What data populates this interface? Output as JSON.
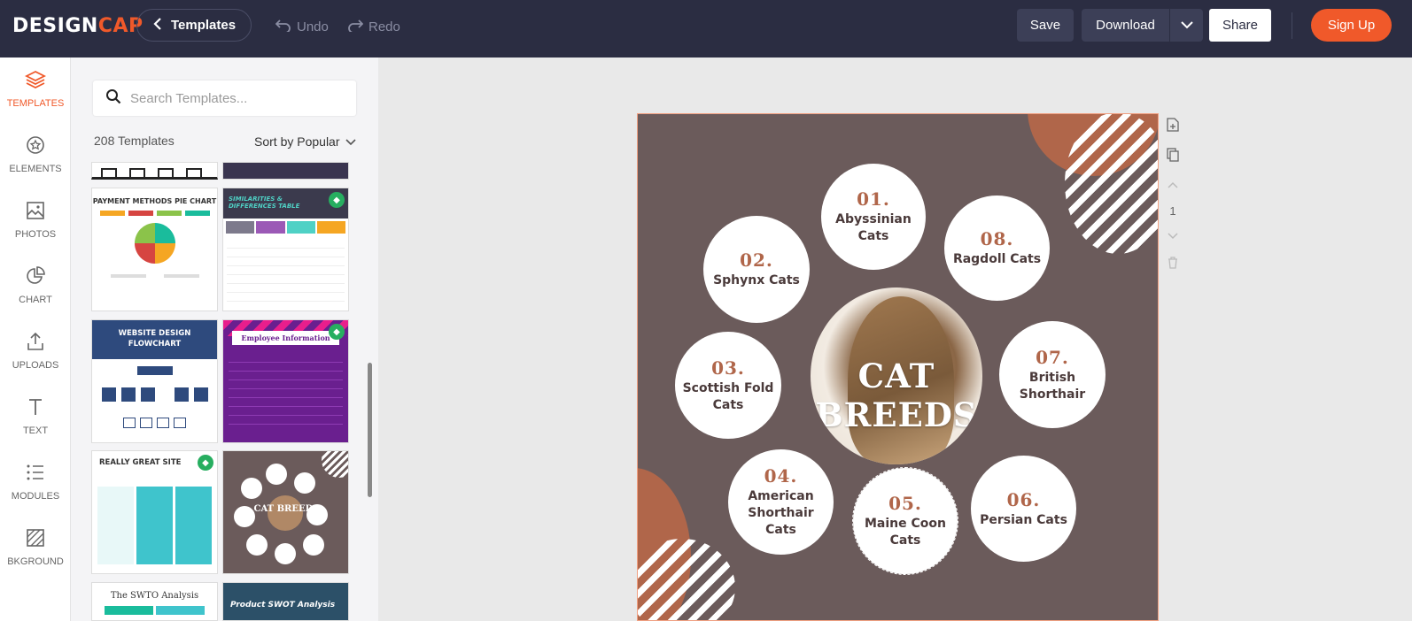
{
  "header": {
    "logo_design": "DESIGN",
    "logo_cap": "CAP",
    "templates_label": "Templates",
    "undo_label": "Undo",
    "redo_label": "Redo",
    "save_label": "Save",
    "download_label": "Download",
    "share_label": "Share",
    "signup_label": "Sign Up"
  },
  "rail": {
    "items": [
      {
        "label": "TEMPLATES",
        "icon": "layers-icon"
      },
      {
        "label": "ELEMENTS",
        "icon": "star-badge-icon"
      },
      {
        "label": "PHOTOS",
        "icon": "image-icon"
      },
      {
        "label": "CHART",
        "icon": "pie-chart-icon"
      },
      {
        "label": "UPLOADS",
        "icon": "upload-icon"
      },
      {
        "label": "TEXT",
        "icon": "text-icon"
      },
      {
        "label": "MODULES",
        "icon": "list-icon"
      },
      {
        "label": "BKGROUND",
        "icon": "background-icon"
      }
    ]
  },
  "panel": {
    "search_placeholder": "Search Templates...",
    "count": "208 Templates",
    "sort_label": "Sort by Popular",
    "thumbs": [
      {
        "title": "PAYMENT METHODS PIE CHART"
      },
      {
        "title": "SIMILARITIES & DIFFERENCES TABLE"
      },
      {
        "title": "WEBSITE DESIGN FLOWCHART"
      },
      {
        "title": "Employee Information"
      },
      {
        "title": "REALLY GREAT SITE"
      },
      {
        "title": "CAT BREEDS"
      },
      {
        "title": "The SWTO Analysis"
      },
      {
        "title": "Product SWOT Analysis"
      }
    ]
  },
  "canvas": {
    "title": "CAT BREEDS",
    "breeds": [
      {
        "num": "01.",
        "name": "Abyssinian Cats"
      },
      {
        "num": "02.",
        "name": "Sphynx Cats"
      },
      {
        "num": "03.",
        "name": "Scottish Fold Cats"
      },
      {
        "num": "04.",
        "name": "American Shorthair Cats"
      },
      {
        "num": "05.",
        "name": "Maine Coon Cats"
      },
      {
        "num": "06.",
        "name": "Persian Cats"
      },
      {
        "num": "07.",
        "name": "British Shorthair"
      },
      {
        "num": "08.",
        "name": "Ragdoll Cats"
      }
    ],
    "page_number": "1"
  },
  "colors": {
    "accent": "#f0592a",
    "topbar": "#2b2d42",
    "canvas_bg": "#6b5b5b",
    "terracotta": "#b0664a"
  }
}
